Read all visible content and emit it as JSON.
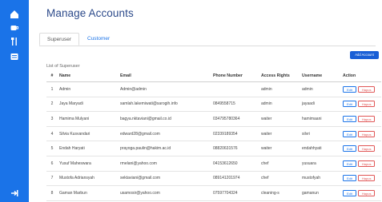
{
  "sidebar": {
    "icons": [
      "dashboard-icon",
      "coffee-icon",
      "restaurant-icon",
      "list-icon",
      "logout-icon"
    ],
    "background": "#1a73e8"
  },
  "page": {
    "title": "Manage Accounts"
  },
  "tabs": [
    {
      "label": "Superuser",
      "active": true
    },
    {
      "label": "Customer",
      "active": false
    }
  ],
  "toolbar": {
    "add_label": "Add Account"
  },
  "list": {
    "label": "List of Superuser"
  },
  "table": {
    "headers": [
      "#",
      "Name",
      "Email",
      "Phone Number",
      "Access Rights",
      "Username",
      "Action"
    ],
    "rows": [
      [
        "1",
        "Admin",
        "Admin@admin",
        "",
        "admin",
        "admin"
      ],
      [
        "2",
        "Jaya Maryadi",
        "samlah.lakemiwati@sarogih.info",
        "0849558715",
        "admin",
        "jayaadi"
      ],
      [
        "3",
        "Hamima Mulyani",
        "bagya.nktaviani@gmail.co.id",
        "034795780364",
        "waiter",
        "hamimaani"
      ],
      [
        "4",
        "Silvia Kusvandari",
        "edward28@gmail.com",
        "02339189354",
        "waiter",
        "silvri"
      ],
      [
        "5",
        "Endah Haryati",
        "prayoga.paulin@hakim.ac.id",
        "08820631576",
        "waiter",
        "endahhyati"
      ],
      [
        "6",
        "Yusuf Maheswara",
        "rmelani@yahoo.com",
        "04153612650",
        "chef",
        "yusuara"
      ],
      [
        "7",
        "Mustofa Adriansyah",
        "sektaviani@gmail.com",
        "089141201974",
        "chef",
        "mustofyah"
      ],
      [
        "8",
        "Gaman Marbun",
        "usamosir@yahoo.com",
        "07597704324",
        "cleaning-s",
        "gamanun"
      ]
    ],
    "edit_label": "Edit",
    "delete_label": "Hapus"
  },
  "colors": {
    "accent": "#1a73e8",
    "title": "#2c4a8a",
    "danger": "#e05555"
  }
}
